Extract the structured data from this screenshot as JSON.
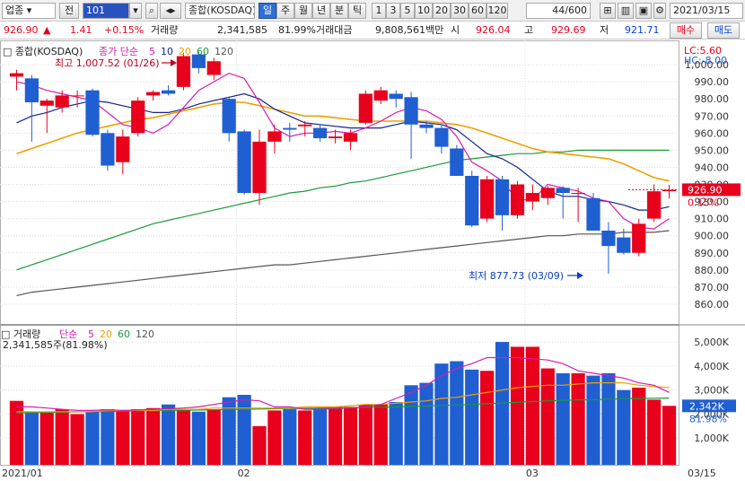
{
  "toolbar": {
    "sector_combo": "업종",
    "sector_tab": "전",
    "code": "101",
    "index_name": "종합(KOSDAQ)",
    "periods": [
      "일",
      "주",
      "월",
      "년",
      "분",
      "틱"
    ],
    "active_period": "일",
    "intervals": [
      "1",
      "3",
      "5",
      "10",
      "20",
      "30",
      "60",
      "120"
    ],
    "page_counter": "44/600",
    "date": "2021/03/15"
  },
  "infobar": {
    "price": "926.90",
    "change_arrow": "▲",
    "change": "1.41",
    "change_pct": "+0.15%",
    "volume_label": "거래량",
    "volume": "2,341,585",
    "volume_ratio": "81.99%",
    "turnover_label": "거래대금",
    "turnover": "9,808,561백만",
    "open_label": "시",
    "open": "926.04",
    "high_label": "고",
    "high": "929.69",
    "low_label": "저",
    "low": "921.71",
    "buy_label": "매수",
    "sell_label": "매도"
  },
  "price_panel": {
    "legend_title": "종합(KOSDAQ)",
    "legend_ma_label": "종가 단순",
    "legend_ma_periods": [
      "5",
      "10",
      "20",
      "60",
      "120"
    ],
    "lc_label": "LC:5.60",
    "hc_label": "HC:-8.00",
    "max_annotation": "최고 1,007.52 (01/26)",
    "min_annotation": "최저 877.73 (03/09)",
    "current_price_box": "926.90",
    "current_pct": "0.15%"
  },
  "volume_panel": {
    "legend_title": "거래량",
    "legend_ma_label": "단순",
    "legend_ma_periods": [
      "5",
      "20",
      "60",
      "120"
    ],
    "current_text": "2,341,585주(81.98%)",
    "current_box": "2,342K",
    "current_pct": "81.98%"
  },
  "x_labels": [
    "2021/01",
    "02",
    "03",
    "03/15"
  ],
  "colors": {
    "up": "#e8001c",
    "down": "#1f5fd2",
    "ma5": "#d81bb0",
    "ma10": "#13238a",
    "ma20": "#f0a000",
    "ma60": "#1a9a3a",
    "ma120": "#555555",
    "grid": "#dcdcdc"
  },
  "chart_data": [
    {
      "type": "candlestick",
      "title": "종합(KOSDAQ)",
      "ylim": [
        850,
        1010
      ],
      "y_ticks": [
        860,
        870,
        880,
        890,
        900,
        910,
        920,
        930,
        940,
        950,
        960,
        970,
        980,
        990,
        1000
      ],
      "candles": [
        {
          "o": 993,
          "h": 997,
          "l": 985,
          "c": 995
        },
        {
          "o": 992,
          "h": 994,
          "l": 955,
          "c": 978
        },
        {
          "o": 976,
          "h": 980,
          "l": 960,
          "c": 979
        },
        {
          "o": 975,
          "h": 985,
          "l": 972,
          "c": 982
        },
        {
          "o": 982,
          "h": 985,
          "l": 975,
          "c": 982
        },
        {
          "o": 985,
          "h": 986,
          "l": 958,
          "c": 959
        },
        {
          "o": 960,
          "h": 962,
          "l": 938,
          "c": 941
        },
        {
          "o": 943,
          "h": 962,
          "l": 936,
          "c": 958
        },
        {
          "o": 960,
          "h": 981,
          "l": 958,
          "c": 979
        },
        {
          "o": 982,
          "h": 985,
          "l": 979,
          "c": 984
        },
        {
          "o": 985,
          "h": 988,
          "l": 982,
          "c": 983
        },
        {
          "o": 987,
          "h": 1007,
          "l": 985,
          "c": 1005
        },
        {
          "o": 1006,
          "h": 1007.52,
          "l": 995,
          "c": 998
        },
        {
          "o": 994,
          "h": 1004,
          "l": 991,
          "c": 1002
        },
        {
          "o": 980,
          "h": 981,
          "l": 955,
          "c": 960
        },
        {
          "o": 961,
          "h": 962,
          "l": 924,
          "c": 925
        },
        {
          "o": 925,
          "h": 962,
          "l": 918,
          "c": 955
        },
        {
          "o": 955,
          "h": 965,
          "l": 948,
          "c": 961
        },
        {
          "o": 963,
          "h": 966,
          "l": 955,
          "c": 962
        },
        {
          "o": 964,
          "h": 967,
          "l": 958,
          "c": 965
        },
        {
          "o": 963,
          "h": 965,
          "l": 955,
          "c": 957
        },
        {
          "o": 957,
          "h": 962,
          "l": 954,
          "c": 958
        },
        {
          "o": 955,
          "h": 962,
          "l": 950,
          "c": 960
        },
        {
          "o": 966,
          "h": 985,
          "l": 965,
          "c": 983
        },
        {
          "o": 979,
          "h": 987,
          "l": 977,
          "c": 985
        },
        {
          "o": 983,
          "h": 985,
          "l": 975,
          "c": 980
        },
        {
          "o": 981,
          "h": 984,
          "l": 945,
          "c": 965
        },
        {
          "o": 965,
          "h": 967,
          "l": 960,
          "c": 963
        },
        {
          "o": 963,
          "h": 965,
          "l": 948,
          "c": 952
        },
        {
          "o": 951,
          "h": 953,
          "l": 935,
          "c": 935
        },
        {
          "o": 935,
          "h": 938,
          "l": 905,
          "c": 906
        },
        {
          "o": 910,
          "h": 935,
          "l": 908,
          "c": 933
        },
        {
          "o": 933,
          "h": 935,
          "l": 903,
          "c": 912
        },
        {
          "o": 912,
          "h": 932,
          "l": 910,
          "c": 930
        },
        {
          "o": 920,
          "h": 930,
          "l": 915,
          "c": 925
        },
        {
          "o": 922,
          "h": 929,
          "l": 918,
          "c": 928
        },
        {
          "o": 928,
          "h": 929,
          "l": 910,
          "c": 925
        },
        {
          "o": 925,
          "h": 928,
          "l": 908,
          "c": 925
        },
        {
          "o": 922,
          "h": 925,
          "l": 915,
          "c": 903
        },
        {
          "o": 903,
          "h": 908,
          "l": 877.73,
          "c": 894
        },
        {
          "o": 899,
          "h": 904,
          "l": 889,
          "c": 890
        },
        {
          "o": 890,
          "h": 910,
          "l": 888,
          "c": 907
        },
        {
          "o": 910,
          "h": 930,
          "l": 908,
          "c": 926
        },
        {
          "o": 926.04,
          "h": 929.69,
          "l": 921.71,
          "c": 926.9
        }
      ],
      "ma5": [
        990,
        988,
        985,
        983,
        981,
        979,
        972,
        965,
        963,
        960,
        965,
        975,
        985,
        990,
        995,
        992,
        978,
        963,
        958,
        960,
        960,
        961,
        960,
        963,
        967,
        972,
        975,
        973,
        968,
        958,
        943,
        938,
        932,
        921,
        921,
        930,
        928,
        926,
        922,
        920,
        910,
        905,
        904,
        910
      ],
      "ma10": [
        966,
        970,
        972,
        975,
        977,
        979,
        978,
        976,
        974,
        972,
        972,
        974,
        977,
        979,
        981,
        983,
        980,
        974,
        970,
        966,
        965,
        964,
        963,
        963,
        963,
        965,
        967,
        966,
        965,
        962,
        955,
        948,
        945,
        940,
        933,
        926,
        923,
        923,
        921,
        920,
        918,
        915,
        915,
        917
      ],
      "ma20": [
        948,
        951,
        954,
        957,
        960,
        962,
        964,
        966,
        968,
        969,
        971,
        973,
        975,
        977,
        978,
        978,
        976,
        974,
        972,
        970,
        970,
        969,
        968,
        967,
        967,
        967,
        967,
        967,
        966,
        965,
        963,
        960,
        957,
        954,
        951,
        949,
        948,
        947,
        946,
        945,
        942,
        938,
        934,
        932
      ],
      "ma60": [
        880,
        883,
        886,
        889,
        892,
        895,
        898,
        901,
        904,
        907,
        909,
        911,
        913,
        915,
        917,
        919,
        921,
        923,
        925,
        926,
        928,
        929,
        931,
        932,
        934,
        936,
        938,
        940,
        942,
        944,
        945,
        946,
        947,
        948,
        948,
        949,
        949,
        950,
        950,
        950,
        950,
        950,
        950,
        950
      ],
      "ma120": [
        865,
        867,
        868,
        869,
        870,
        871,
        872,
        873,
        874,
        875,
        876,
        877,
        878,
        879,
        880,
        881,
        882,
        883,
        883,
        884,
        885,
        886,
        887,
        888,
        889,
        890,
        891,
        892,
        893,
        894,
        895,
        896,
        897,
        898,
        899,
        900,
        900,
        901,
        901,
        901,
        902,
        902,
        902,
        903
      ]
    },
    {
      "type": "bar",
      "title": "거래량",
      "ylim": [
        0,
        5600
      ],
      "y_unit": "K",
      "y_ticks": [
        1000,
        2000,
        3000,
        4000,
        5000
      ],
      "volumes": [
        2550,
        2100,
        2100,
        2200,
        2000,
        2100,
        2200,
        2150,
        2200,
        2250,
        2400,
        2200,
        2100,
        2200,
        2700,
        2800,
        1500,
        2150,
        2200,
        2150,
        2250,
        2300,
        2300,
        2400,
        2400,
        2500,
        3200,
        3300,
        4100,
        4200,
        3850,
        3800,
        5000,
        4800,
        4800,
        3900,
        3700,
        3700,
        3600,
        3700,
        3000,
        3100,
        2600,
        2342
      ],
      "ma5": [
        2300,
        2300,
        2250,
        2200,
        2150,
        2150,
        2180,
        2150,
        2170,
        2200,
        2220,
        2250,
        2300,
        2400,
        2500,
        2600,
        2550,
        2300,
        2300,
        2200,
        2200,
        2230,
        2250,
        2300,
        2400,
        2650,
        2900,
        3200,
        3600,
        3900,
        4100,
        4350,
        4350,
        4350,
        4300,
        4250,
        4100,
        3800,
        3700,
        3600,
        3500,
        3300,
        3200,
        2900
      ],
      "ma20": [
        2100,
        2100,
        2100,
        2100,
        2100,
        2100,
        2150,
        2150,
        2150,
        2150,
        2200,
        2200,
        2200,
        2250,
        2250,
        2250,
        2250,
        2250,
        2250,
        2300,
        2300,
        2300,
        2350,
        2400,
        2400,
        2450,
        2500,
        2550,
        2650,
        2700,
        2800,
        2900,
        3000,
        3100,
        3150,
        3200,
        3200,
        3250,
        3300,
        3300,
        3300,
        3200,
        3150,
        3100
      ],
      "ma60": [
        2050,
        2060,
        2070,
        2080,
        2090,
        2100,
        2110,
        2120,
        2130,
        2140,
        2150,
        2160,
        2170,
        2180,
        2190,
        2200,
        2210,
        2220,
        2230,
        2240,
        2250,
        2260,
        2270,
        2280,
        2290,
        2300,
        2320,
        2340,
        2360,
        2380,
        2400,
        2430,
        2460,
        2490,
        2520,
        2550,
        2570,
        2590,
        2600,
        2620,
        2640,
        2650,
        2660,
        2670
      ]
    }
  ]
}
